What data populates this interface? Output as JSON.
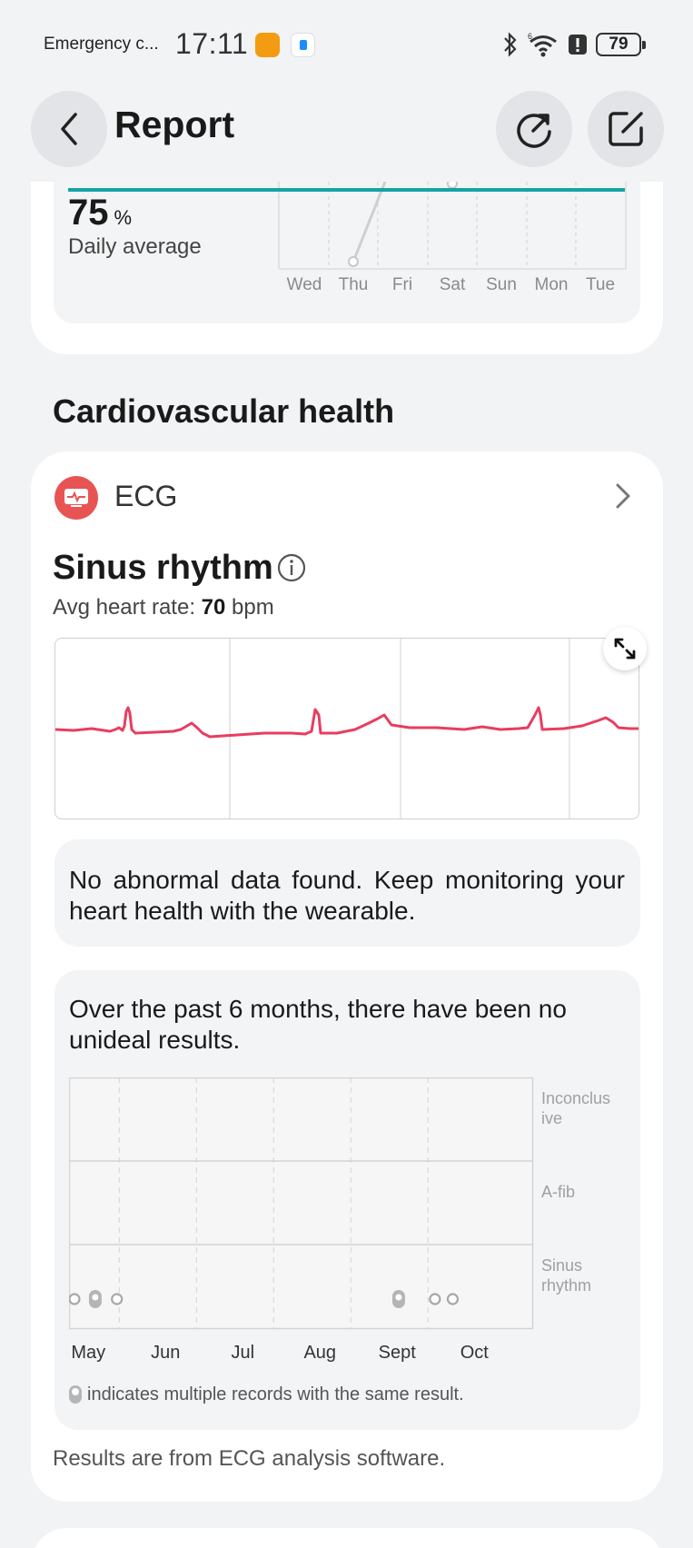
{
  "status_bar": {
    "carrier": "Emergency c...",
    "time": "17:11",
    "battery": "79"
  },
  "header": {
    "title": "Report"
  },
  "weekly_summary": {
    "value": "75",
    "unit": "%",
    "caption": "Daily average",
    "days": [
      "Wed",
      "Thu",
      "Fri",
      "Sat",
      "Sun",
      "Mon",
      "Tue"
    ]
  },
  "cardiovascular": {
    "section_title": "Cardiovascular health",
    "ecg": {
      "label": "ECG",
      "result": "Sinus rhythm",
      "avg_hr_label": "Avg heart rate:",
      "avg_hr_value": "70",
      "avg_hr_unit": "bpm",
      "message": "No abnormal data found. Keep monitoring your heart health with the wearable.",
      "history_text": "Over the past 6 months, there have been no unideal results.",
      "legend_text": "indicates multiple records with the same result.",
      "footnote": "Results are from ECG analysis software."
    }
  },
  "chart_data": {
    "type": "scatter",
    "title": "",
    "x_categories": [
      "May",
      "Jun",
      "Jul",
      "Aug",
      "Sept",
      "Oct"
    ],
    "y_categories": [
      "Sinus rhythm",
      "A-fib",
      "Inconclusive"
    ],
    "y_labels_display": [
      [
        "Inconclus",
        "ive"
      ],
      [
        "A-fib"
      ],
      [
        "Sinus",
        "rhythm"
      ]
    ],
    "grid": true,
    "points": [
      {
        "month": "May",
        "offset": 0.15,
        "result": "Sinus rhythm",
        "multiple": false
      },
      {
        "month": "May",
        "offset": 0.42,
        "result": "Sinus rhythm",
        "multiple": true
      },
      {
        "month": "May",
        "offset": 0.7,
        "result": "Sinus rhythm",
        "multiple": false
      },
      {
        "month": "Sept",
        "offset": 0.35,
        "result": "Sinus rhythm",
        "multiple": true
      },
      {
        "month": "Sept",
        "offset": 0.82,
        "result": "Sinus rhythm",
        "multiple": false
      },
      {
        "month": "Oct",
        "offset": 0.05,
        "result": "Sinus rhythm",
        "multiple": false
      }
    ]
  },
  "colors": {
    "accent_teal": "#16a3a3",
    "ecg_red": "#e83d5f",
    "ecg_icon": "#e85454"
  }
}
